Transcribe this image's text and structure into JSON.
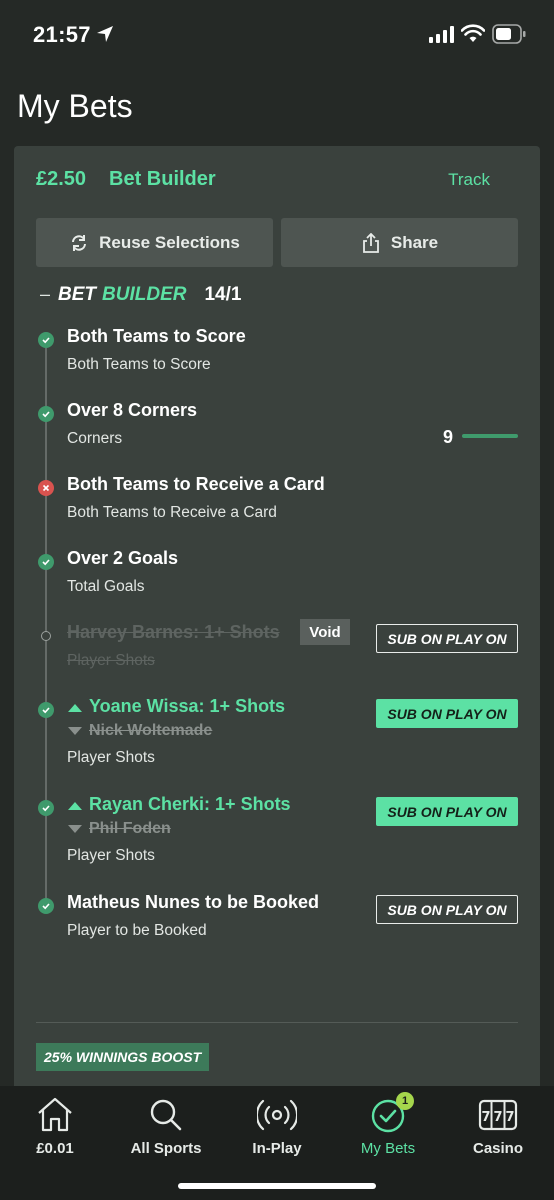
{
  "status_bar": {
    "time": "21:57"
  },
  "page": {
    "title": "My Bets"
  },
  "bet": {
    "stake": "£2.50",
    "type": "Bet Builder",
    "track_label": "Track",
    "reuse_label": "Reuse Selections",
    "share_label": "Share",
    "builder_word1": "BET",
    "builder_word2": "BUILDER",
    "odds": "14/1",
    "legs": [
      {
        "title": "Both Teams to Score",
        "market": "Both Teams to Score",
        "status": "won"
      },
      {
        "title": "Over 8 Corners",
        "market": "Corners",
        "status": "won",
        "progress_value": "9"
      },
      {
        "title": "Both Teams to Receive a Card",
        "market": "Both Teams to Receive a Card",
        "status": "lost"
      },
      {
        "title": "Over 2 Goals",
        "market": "Total Goals",
        "status": "won"
      },
      {
        "title": "Harvey Barnes: 1+ Shots",
        "market": "Player Shots",
        "status": "void",
        "void_label": "Void",
        "sub_label": "SUB ON PLAY ON"
      },
      {
        "title": "Yoane Wissa: 1+ Shots",
        "replaced": "Nick Woltemade",
        "market": "Player Shots",
        "status": "won",
        "sub_label": "SUB ON PLAY ON"
      },
      {
        "title": "Rayan Cherki: 1+ Shots",
        "replaced": "Phil Foden",
        "market": "Player Shots",
        "status": "won",
        "sub_label": "SUB ON PLAY ON"
      },
      {
        "title": "Matheus Nunes to be Booked",
        "market": "Player to be Booked",
        "status": "won",
        "sub_label": "SUB ON PLAY ON"
      }
    ],
    "boost_label": "25% WINNINGS BOOST"
  },
  "nav": {
    "items": [
      {
        "label": "£0.01",
        "icon": "home-icon"
      },
      {
        "label": "All Sports",
        "icon": "search-icon"
      },
      {
        "label": "In-Play",
        "icon": "broadcast-icon"
      },
      {
        "label": "My Bets",
        "icon": "check-circle-icon",
        "badge": "1",
        "active": true
      },
      {
        "label": "Casino",
        "icon": "slot-machine-icon"
      }
    ]
  },
  "colors": {
    "accent": "#5ce1a4",
    "card": "#3a413d",
    "background": "#252926",
    "win": "#3f9a6c",
    "lose": "#d9534f"
  }
}
